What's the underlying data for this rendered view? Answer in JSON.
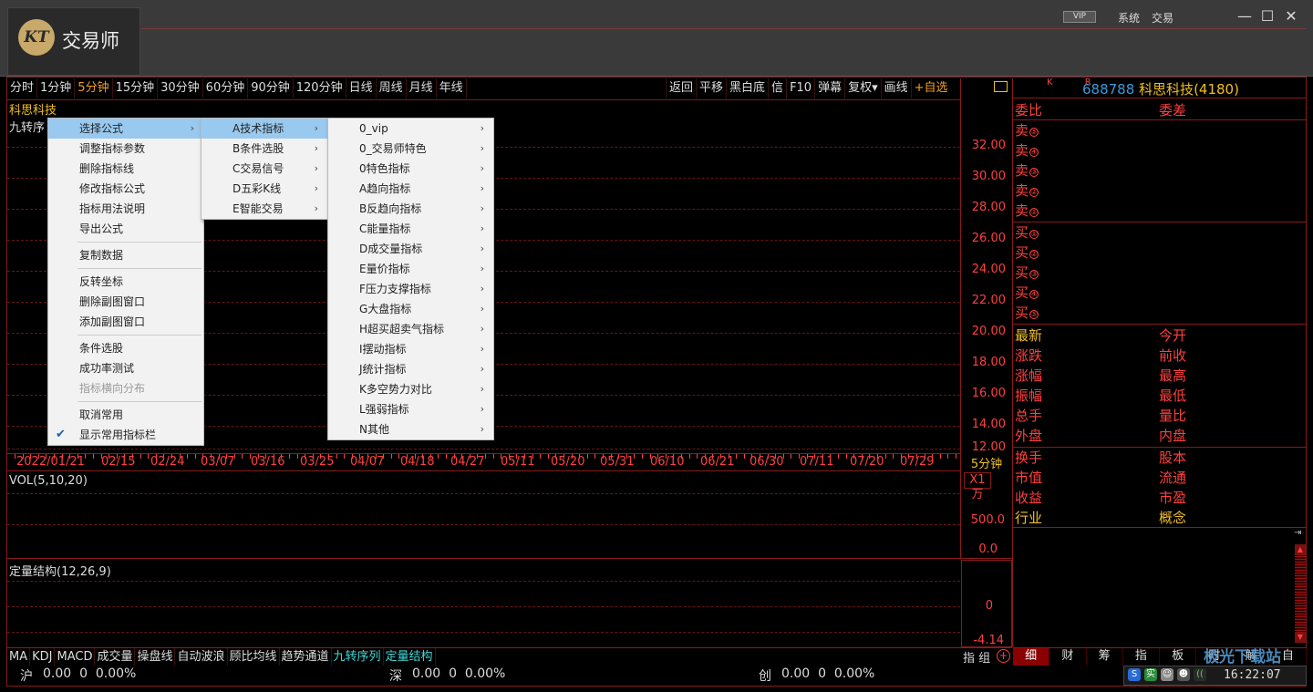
{
  "app": {
    "logo_mark": "KT",
    "logo_text": "交易师",
    "vip_badge": "VIP",
    "menu": [
      "系统",
      "交易"
    ],
    "minimize": "—",
    "maximize": "☐",
    "close": "✕"
  },
  "periods": [
    "分时",
    "1分钟",
    "5分钟",
    "15分钟",
    "30分钟",
    "60分钟",
    "90分钟",
    "120分钟",
    "日线",
    "周线",
    "月线",
    "年线"
  ],
  "active_period": "5分钟",
  "tools": [
    "返回",
    "平移",
    "黑白底",
    "信",
    "F10",
    "弹幕",
    "复权▾",
    "画线",
    "+自选"
  ],
  "chart": {
    "stock_name": "科思科技",
    "indicator_label": "九转序",
    "price_axis": [
      "32.00",
      "30.00",
      "28.00",
      "26.00",
      "24.00",
      "22.00",
      "20.00",
      "18.00",
      "16.00",
      "14.00",
      "12.00"
    ],
    "dates": [
      "2022/01/21",
      "02/15",
      "02/24",
      "03/07",
      "03/16",
      "03/25",
      "04/07",
      "04/18",
      "04/27",
      "05/11",
      "05/20",
      "05/31",
      "06/10",
      "06/21",
      "06/30",
      "07/11",
      "07/20",
      "07/29"
    ],
    "period_label": "5分钟",
    "vol_label": "VOL(5,10,20)",
    "unit_label": "X1万",
    "vol_axis": [
      "500.0",
      "0.0"
    ],
    "sub2_label": "定量结构(12,26,9)",
    "sub2_axis": [
      "0",
      "-4.14"
    ]
  },
  "indicator_tabs": [
    "MA",
    "KDJ",
    "MACD",
    "成交量",
    "操盘线",
    "自动波浪",
    "顾比均线",
    "趋势通道",
    "九转序列",
    "定量结构"
  ],
  "active_indicator_tabs": [
    "九转序列",
    "定量结构"
  ],
  "chart_right_tabs": "指 组",
  "status": {
    "sh": {
      "label": "沪",
      "value": "0.00  0  0.00%"
    },
    "sz": {
      "label": "深",
      "value": "0.00  0  0.00%"
    },
    "cy": {
      "label": "创",
      "value": "0.00  0  0.00%"
    },
    "time": "16:22:07"
  },
  "quote": {
    "kr": "K R",
    "code": "688788",
    "name": "科思科技",
    "id": "(4180)",
    "row_top": [
      "委比",
      "委差"
    ],
    "sell": [
      "卖",
      "卖",
      "卖",
      "卖",
      "卖"
    ],
    "sell_num": [
      "⑤",
      "④",
      "③",
      "②",
      "①"
    ],
    "buy": [
      "买",
      "买",
      "买",
      "买",
      "买"
    ],
    "buy_num": [
      "①",
      "②",
      "③",
      "④",
      "⑤"
    ],
    "fields_left": [
      "最新",
      "涨跌",
      "涨幅",
      "振幅",
      "总手",
      "外盘"
    ],
    "fields_right": [
      "今开",
      "前收",
      "最高",
      "最低",
      "量比",
      "内盘"
    ],
    "fields2_left": [
      "换手",
      "市值",
      "收益",
      "行业"
    ],
    "fields2_right": [
      "股本",
      "流通",
      "市盈",
      "概念"
    ]
  },
  "right_tabs": [
    "细",
    "财",
    "筹",
    "指",
    "板",
    "时",
    "解",
    "自"
  ],
  "watermark": "极光下载站",
  "menu1": {
    "groups": [
      [
        "选择公式",
        "调整指标参数",
        "删除指标线",
        "修改指标公式",
        "指标用法说明",
        "导出公式"
      ],
      [
        "复制数据"
      ],
      [
        "反转坐标",
        "删除副图窗口",
        "添加副图窗口"
      ],
      [
        "条件选股",
        "成功率测试",
        "指标横向分布"
      ],
      [
        "取消常用",
        "显示常用指标栏"
      ]
    ]
  },
  "menu2": [
    "A技术指标",
    "B条件选股",
    "C交易信号",
    "D五彩K线",
    "E智能交易"
  ],
  "menu3": [
    "0_vip",
    "0_交易师特色",
    "0特色指标",
    "A趋向指标",
    "B反趋向指标",
    "C能量指标",
    "D成交量指标",
    "E量价指标",
    "F压力支撑指标",
    "G大盘指标",
    "H超买超卖气指标",
    "I摆动指标",
    "J统计指标",
    "K多空势力对比",
    "L强弱指标",
    "N其他"
  ]
}
